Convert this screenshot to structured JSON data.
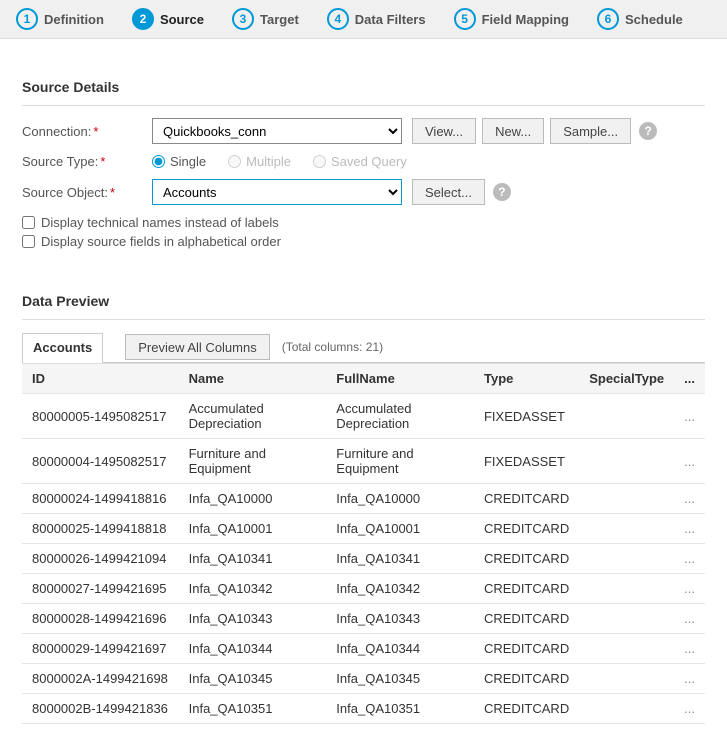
{
  "steps": [
    {
      "num": "1",
      "label": "Definition"
    },
    {
      "num": "2",
      "label": "Source"
    },
    {
      "num": "3",
      "label": "Target"
    },
    {
      "num": "4",
      "label": "Data Filters"
    },
    {
      "num": "5",
      "label": "Field Mapping"
    },
    {
      "num": "6",
      "label": "Schedule"
    }
  ],
  "activeStep": 1,
  "section": {
    "sourceDetailsTitle": "Source Details",
    "dataPreviewTitle": "Data Preview"
  },
  "labels": {
    "connection": "Connection:",
    "sourceType": "Source Type:",
    "sourceObject": "Source Object:",
    "displayTechnical": "Display technical names instead of labels",
    "displayAlphabetical": "Display source fields in alphabetical order"
  },
  "buttons": {
    "view": "View...",
    "new": "New...",
    "sample": "Sample...",
    "select": "Select...",
    "previewAll": "Preview All Columns"
  },
  "connection": {
    "value": "Quickbooks_conn"
  },
  "sourceTypeOptions": {
    "single": "Single",
    "multiple": "Multiple",
    "savedQuery": "Saved Query"
  },
  "sourceObject": {
    "value": "Accounts"
  },
  "preview": {
    "tabLabel": "Accounts",
    "totalColumnsText": "(Total columns: 21)",
    "columns": [
      "ID",
      "Name",
      "FullName",
      "Type",
      "SpecialType",
      "..."
    ],
    "rows": [
      {
        "id": "80000005-1495082517",
        "name": "Accumulated Depreciation",
        "full": "Accumulated Depreciation",
        "type": "FIXEDASSET",
        "sp": ""
      },
      {
        "id": "80000004-1495082517",
        "name": "Furniture and Equipment",
        "full": "Furniture and Equipment",
        "type": "FIXEDASSET",
        "sp": ""
      },
      {
        "id": "80000024-1499418816",
        "name": "Infa_QA10000",
        "full": "Infa_QA10000",
        "type": "CREDITCARD",
        "sp": ""
      },
      {
        "id": "80000025-1499418818",
        "name": "Infa_QA10001",
        "full": "Infa_QA10001",
        "type": "CREDITCARD",
        "sp": ""
      },
      {
        "id": "80000026-1499421094",
        "name": "Infa_QA10341",
        "full": "Infa_QA10341",
        "type": "CREDITCARD",
        "sp": ""
      },
      {
        "id": "80000027-1499421695",
        "name": "Infa_QA10342",
        "full": "Infa_QA10342",
        "type": "CREDITCARD",
        "sp": ""
      },
      {
        "id": "80000028-1499421696",
        "name": "Infa_QA10343",
        "full": "Infa_QA10343",
        "type": "CREDITCARD",
        "sp": ""
      },
      {
        "id": "80000029-1499421697",
        "name": "Infa_QA10344",
        "full": "Infa_QA10344",
        "type": "CREDITCARD",
        "sp": ""
      },
      {
        "id": "8000002A-1499421698",
        "name": "Infa_QA10345",
        "full": "Infa_QA10345",
        "type": "CREDITCARD",
        "sp": ""
      },
      {
        "id": "8000002B-1499421836",
        "name": "Infa_QA10351",
        "full": "Infa_QA10351",
        "type": "CREDITCARD",
        "sp": ""
      }
    ]
  }
}
